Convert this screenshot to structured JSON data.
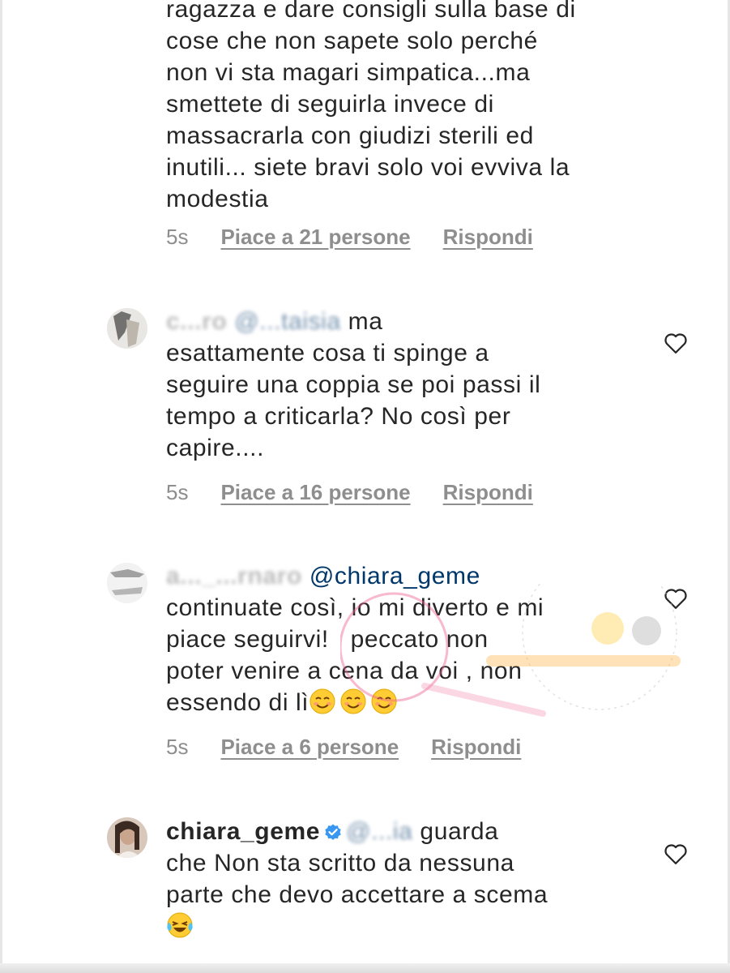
{
  "comments": [
    {
      "lines": [
        "ragazza e dare consigli sulla base di",
        "cose che non sapete solo perché",
        "non vi sta magari simpatica...ma",
        "smettete di seguirla invece di",
        "massacrarla con giudizi sterili ed",
        "inutili... siete bravi solo voi evviva la",
        "modestia"
      ],
      "time": "5s",
      "likes": "Piace a 21 persone",
      "reply": "Rispondi"
    },
    {
      "username": "c...ro",
      "mention": "@...taisia",
      "first_line_rest": " ma",
      "lines": [
        "esattamente cosa ti spinge a",
        "seguire una coppia se poi passi il",
        "tempo a criticarla? No così per",
        "capire...."
      ],
      "time": "5s",
      "likes": "Piace a 16 persone",
      "reply": "Rispondi"
    },
    {
      "username": "a..._...rnaro",
      "mention": "@chiara_geme",
      "lines": [
        "continuate così, io mi diverto e mi",
        "piace seguirvi!   peccato non",
        "poter venire a cena da voi , non",
        "essendo di lì"
      ],
      "emoji": [
        "smiling-face-icon",
        "smiling-face-icon",
        "smiling-face-icon"
      ],
      "time": "5s",
      "likes": "Piace a 6 persone",
      "reply": "Rispondi"
    },
    {
      "username": "chiara_geme",
      "mention": "@...ia",
      "first_line_rest": " guarda",
      "lines": [
        "che Non sta scritto da nessuna",
        "parte che devo accettare a scema"
      ],
      "emoji": [
        "laughing-tears-icon"
      ]
    }
  ],
  "colors": {
    "text": "#262626",
    "meta": "#8e8e8e",
    "mention": "#00376b",
    "verified": "#3897f0"
  }
}
